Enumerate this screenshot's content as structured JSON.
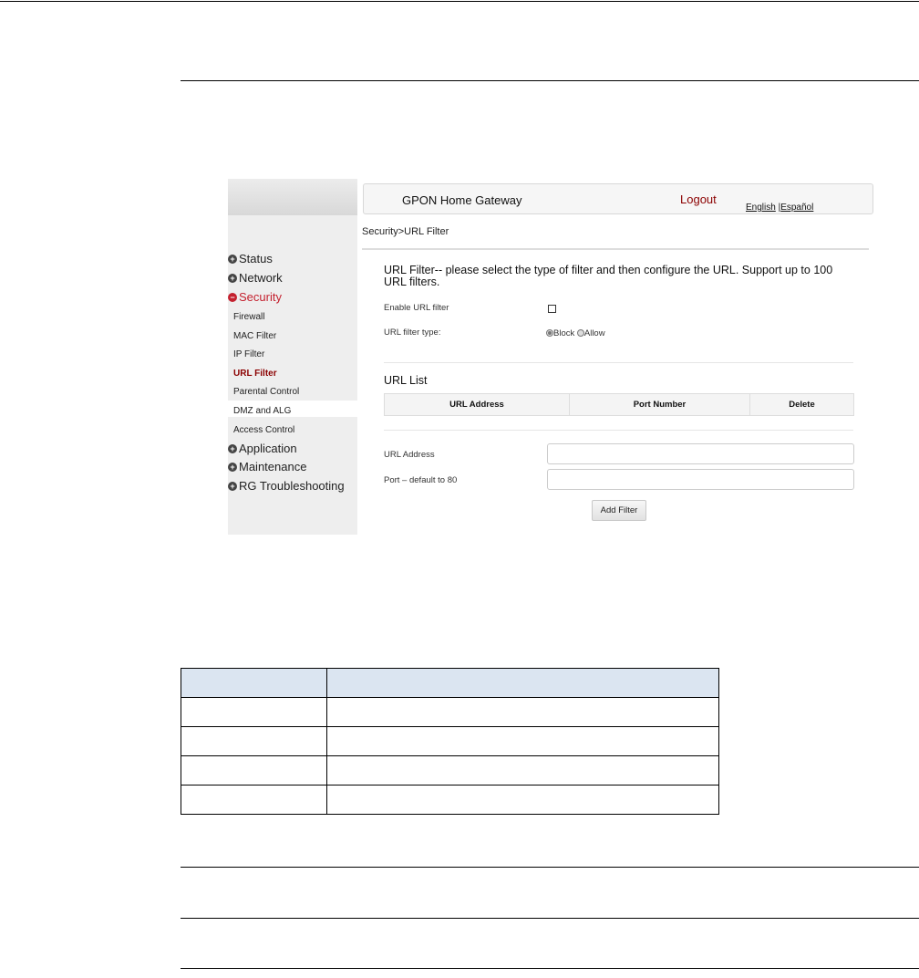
{
  "gateway": {
    "brand": "GPON Home Gateway",
    "logout": "Logout",
    "lang_english": "English",
    "lang_separator": " |",
    "lang_spanish": "Español"
  },
  "breadcrumb": "Security>URL Filter",
  "sidebar": {
    "status": "Status",
    "network": "Network",
    "security": "Security",
    "firewall": "Firewall",
    "mac_filter": "MAC Filter",
    "ip_filter": "IP Filter",
    "url_filter": "URL Filter",
    "parental_control": "Parental Control",
    "dmz_alg": "DMZ and ALG",
    "access_control": "Access Control",
    "application": "Application",
    "maintenance": "Maintenance",
    "rg_troubleshooting": "RG Troubleshooting"
  },
  "content": {
    "intro": "URL Filter-- please select the type of filter and then configure the URL. Support up to 100 URL filters.",
    "enable_label": "Enable URL filter",
    "type_label": "URL filter type:",
    "block": "Block",
    "allow": "Allow",
    "list_title": "URL List",
    "col_url": "URL Address",
    "col_port": "Port Number",
    "col_delete": "Delete",
    "url_label": "URL Address",
    "port_label": "Port – default to 80",
    "add_button": "Add Filter"
  },
  "colors": {
    "active_menu": "#c4212f",
    "active_submenu": "#8b0000",
    "table_header": "#dbe5f1"
  }
}
